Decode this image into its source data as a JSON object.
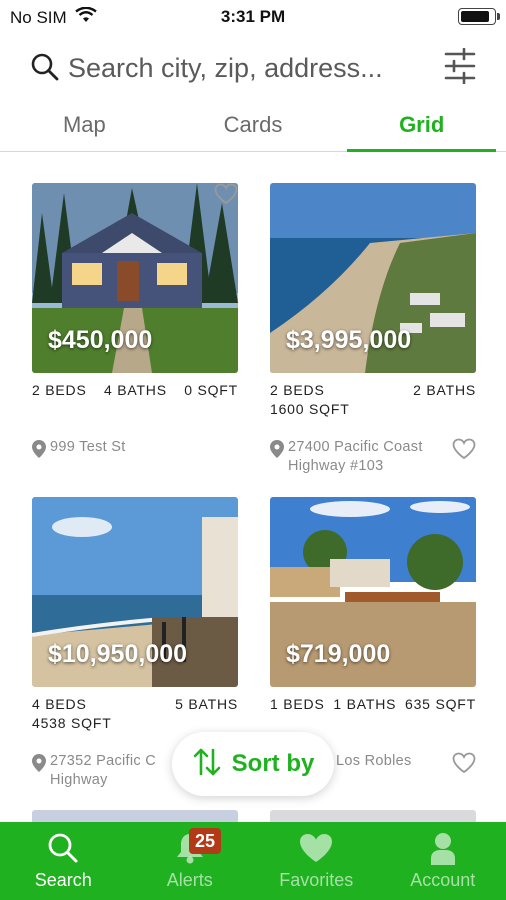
{
  "status_bar": {
    "carrier": "No SIM",
    "time": "3:31 PM"
  },
  "search": {
    "placeholder": "Search city, zip, address..."
  },
  "tabs": [
    {
      "label": "Map",
      "active": false
    },
    {
      "label": "Cards",
      "active": false
    },
    {
      "label": "Grid",
      "active": true
    }
  ],
  "listings": [
    {
      "price": "$450,000",
      "specs_line1_left": "2 BEDS",
      "specs_line1_mid": "4 BATHS",
      "specs_line1_right": "0 SQFT",
      "specs_line2": "",
      "address": "999 Test St",
      "image": "house-exterior"
    },
    {
      "price": "$3,995,000",
      "specs_line1_left": "2 BEDS",
      "specs_line1_mid": "",
      "specs_line1_right": "2 BATHS",
      "specs_line2": "1600 SQFT",
      "address": "27400 Pacific Coast Highway #103",
      "image": "coastline-aerial"
    },
    {
      "price": "$10,950,000",
      "specs_line1_left": "4 BEDS",
      "specs_line1_mid": "",
      "specs_line1_right": "5 BATHS",
      "specs_line2": "4538 SQFT",
      "address": "27352 Pacific C Highway",
      "image": "beach-deck"
    },
    {
      "price": "$719,000",
      "specs_line1_left": "1 BEDS",
      "specs_line1_mid": "1 BATHS",
      "specs_line1_right": "635 SQFT",
      "specs_line2": "",
      "address": "Los Robles",
      "image": "dirt-lot"
    }
  ],
  "sort_button": {
    "label": "Sort by"
  },
  "bottom_nav": [
    {
      "label": "Search",
      "icon": "search-icon",
      "active": true
    },
    {
      "label": "Alerts",
      "icon": "bell-icon",
      "active": false,
      "badge": "25"
    },
    {
      "label": "Favorites",
      "icon": "heart-icon",
      "active": false
    },
    {
      "label": "Account",
      "icon": "person-icon",
      "active": false
    }
  ],
  "colors": {
    "accent": "#1fb11f",
    "badge": "#b33a17"
  }
}
